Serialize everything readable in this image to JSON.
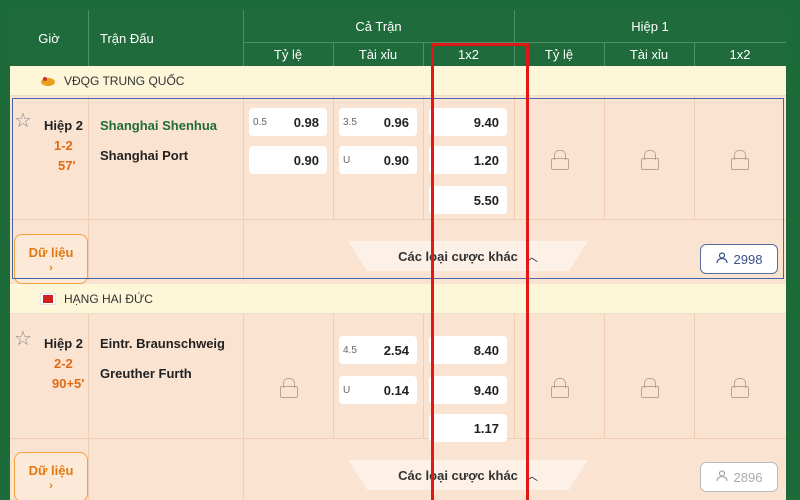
{
  "header": {
    "time": "Giờ",
    "match": "Trận Đấu",
    "full_match": "Cả Trận",
    "first_half": "Hiệp 1",
    "handicap": "Tỷ lệ",
    "over_under": "Tài xỉu",
    "one_x_two": "1x2"
  },
  "leagues": [
    {
      "name": "VĐQG TRUNG QUỐC",
      "match": {
        "period": "Hiệp 2",
        "score": "1-2",
        "minute": "57'",
        "home": "Shanghai Shenhua",
        "away": "Shanghai Port",
        "handicap": {
          "line": "0.5",
          "home": "0.98",
          "away": "0.90"
        },
        "over_under": {
          "line": "3.5",
          "over": "0.96",
          "under_label": "U",
          "under": "0.90"
        },
        "x12": {
          "home": "9.40",
          "draw": "1.20",
          "away": "5.50"
        },
        "data_label": "Dữ liệu",
        "other_bets": "Các loại cược khác",
        "viewers": "2998"
      }
    },
    {
      "name": "HẠNG HAI ĐỨC",
      "match": {
        "period": "Hiệp 2",
        "score": "2-2",
        "minute": "90+5'",
        "home": "Eintr. Braunschweig",
        "away": "Greuther Furth",
        "over_under": {
          "line": "4.5",
          "over": "2.54",
          "under_label": "U",
          "under": "0.14"
        },
        "x12": {
          "home": "8.40",
          "draw": "9.40",
          "away": "1.17"
        },
        "data_label": "Dữ liệu",
        "other_bets": "Các loại cược khác",
        "viewers": "2896"
      }
    }
  ],
  "colors": {
    "header_green": "#1f6b3b",
    "accent_orange": "#e06a10",
    "highlight_red": "#e01818"
  }
}
